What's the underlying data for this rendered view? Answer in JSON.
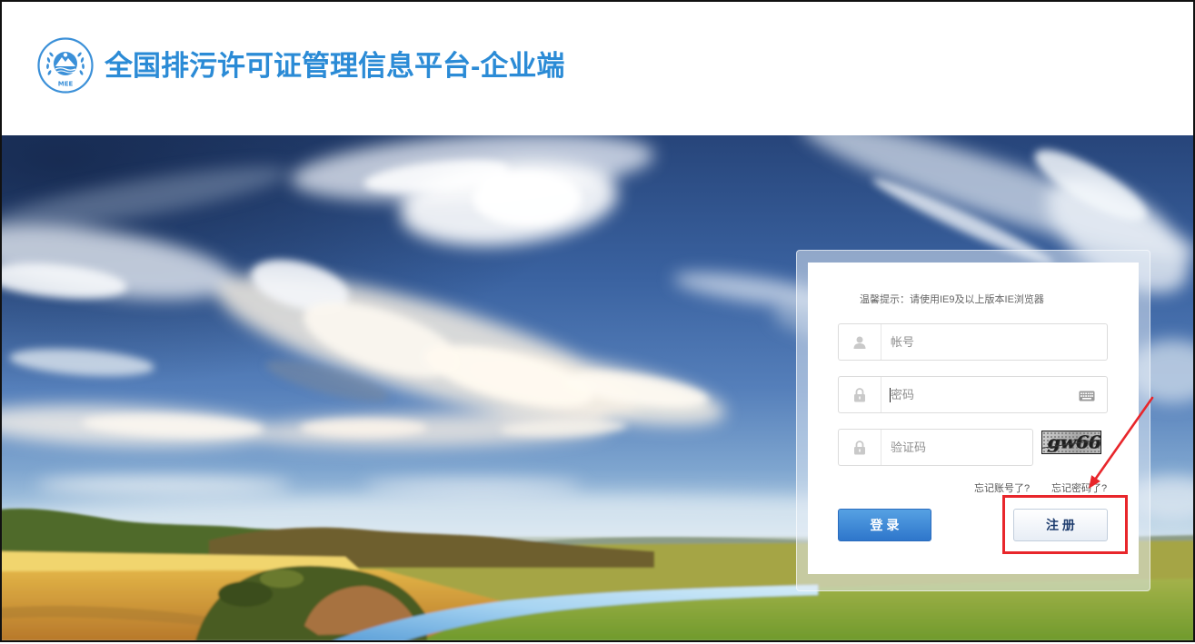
{
  "header": {
    "logo_icon": "mee-emblem-icon",
    "logo_text": "MEE",
    "title": "全国排污许可证管理信息平台-企业端"
  },
  "login": {
    "hint": "温馨提示：请使用IE9及以上版本IE浏览器",
    "account": {
      "icon": "user-icon",
      "placeholder": "帐号"
    },
    "password": {
      "icon": "lock-icon",
      "placeholder": "密码",
      "keyboard_icon": "keyboard-icon"
    },
    "captcha": {
      "icon": "lock-icon",
      "placeholder": "验证码",
      "image_text": "gw66"
    },
    "forgot_account": "忘记账号了?",
    "forgot_password": "忘记密码了?",
    "login_button": "登 录",
    "register_button": "注 册"
  },
  "colors": {
    "title": "#2b8bd6",
    "login_button": "#3a86d4",
    "register_text": "#1e3d6e",
    "annotation": "#e8262b"
  }
}
